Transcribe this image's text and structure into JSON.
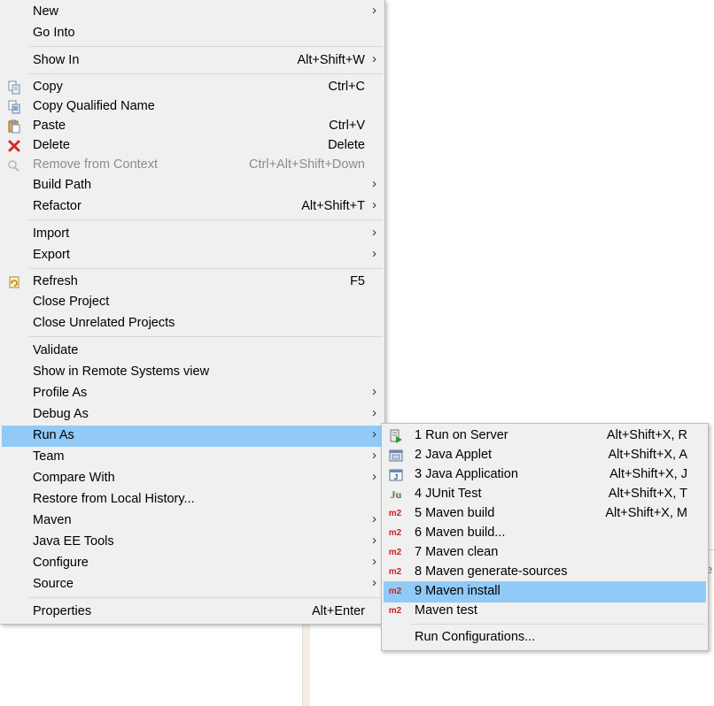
{
  "main_menu": {
    "items": [
      {
        "label": "New",
        "shortcut": "",
        "submenu": true
      },
      {
        "label": "Go Into",
        "shortcut": "",
        "submenu": false
      },
      {
        "label": "Show In",
        "shortcut": "Alt+Shift+W",
        "submenu": true
      },
      {
        "label": "Copy",
        "shortcut": "Ctrl+C",
        "submenu": false,
        "icon": "copy-icon"
      },
      {
        "label": "Copy Qualified Name",
        "shortcut": "",
        "submenu": false,
        "icon": "copy-qualified-name-icon"
      },
      {
        "label": "Paste",
        "shortcut": "Ctrl+V",
        "submenu": false,
        "icon": "paste-icon"
      },
      {
        "label": "Delete",
        "shortcut": "Delete",
        "submenu": false,
        "icon": "delete-icon"
      },
      {
        "label": "Remove from Context",
        "shortcut": "Ctrl+Alt+Shift+Down",
        "submenu": false,
        "icon": "remove-context-icon",
        "disabled": true
      },
      {
        "label": "Build Path",
        "shortcut": "",
        "submenu": true
      },
      {
        "label": "Refactor",
        "shortcut": "Alt+Shift+T",
        "submenu": true
      },
      {
        "label": "Import",
        "shortcut": "",
        "submenu": true
      },
      {
        "label": "Export",
        "shortcut": "",
        "submenu": true
      },
      {
        "label": "Refresh",
        "shortcut": "F5",
        "submenu": false,
        "icon": "refresh-icon"
      },
      {
        "label": "Close Project",
        "shortcut": "",
        "submenu": false
      },
      {
        "label": "Close Unrelated Projects",
        "shortcut": "",
        "submenu": false
      },
      {
        "label": "Validate",
        "shortcut": "",
        "submenu": false
      },
      {
        "label": "Show in Remote Systems view",
        "shortcut": "",
        "submenu": false
      },
      {
        "label": "Profile As",
        "shortcut": "",
        "submenu": true
      },
      {
        "label": "Debug As",
        "shortcut": "",
        "submenu": true
      },
      {
        "label": "Run As",
        "shortcut": "",
        "submenu": true,
        "highlighted": true
      },
      {
        "label": "Team",
        "shortcut": "",
        "submenu": true
      },
      {
        "label": "Compare With",
        "shortcut": "",
        "submenu": true
      },
      {
        "label": "Restore from Local History...",
        "shortcut": "",
        "submenu": false
      },
      {
        "label": "Maven",
        "shortcut": "",
        "submenu": true
      },
      {
        "label": "Java EE Tools",
        "shortcut": "",
        "submenu": true
      },
      {
        "label": "Configure",
        "shortcut": "",
        "submenu": true
      },
      {
        "label": "Source",
        "shortcut": "",
        "submenu": true
      },
      {
        "label": "Properties",
        "shortcut": "Alt+Enter",
        "submenu": false
      }
    ]
  },
  "run_as_menu": {
    "items": [
      {
        "label": "1 Run on Server",
        "shortcut": "Alt+Shift+X, R",
        "icon": "run-on-server-icon"
      },
      {
        "label": "2 Java Applet",
        "shortcut": "Alt+Shift+X, A",
        "icon": "java-applet-icon"
      },
      {
        "label": "3 Java Application",
        "shortcut": "Alt+Shift+X, J",
        "icon": "java-application-icon"
      },
      {
        "label": "4 JUnit Test",
        "shortcut": "Alt+Shift+X, T",
        "icon": "junit-icon",
        "icon_text": "Ju"
      },
      {
        "label": "5 Maven build",
        "shortcut": "Alt+Shift+X, M",
        "icon": "maven-icon",
        "icon_text": "m2"
      },
      {
        "label": "6 Maven build...",
        "shortcut": "",
        "icon": "maven-icon",
        "icon_text": "m2"
      },
      {
        "label": "7 Maven clean",
        "shortcut": "",
        "icon": "maven-icon",
        "icon_text": "m2"
      },
      {
        "label": "8 Maven generate-sources",
        "shortcut": "",
        "icon": "maven-icon",
        "icon_text": "m2"
      },
      {
        "label": "9 Maven install",
        "shortcut": "",
        "icon": "maven-icon",
        "icon_text": "m2",
        "highlighted": true
      },
      {
        "label": "Maven test",
        "shortcut": "",
        "icon": "maven-icon",
        "icon_text": "m2"
      },
      {
        "label": "Run Configurations...",
        "shortcut": ""
      }
    ]
  },
  "submenu_arrow": "›",
  "background_fragment": "e",
  "colors": {
    "menu_bg": "#f0f0f0",
    "highlight": "#91c9f7",
    "maven_red": "#d41f1f",
    "disabled_text": "#8c8c8c"
  }
}
